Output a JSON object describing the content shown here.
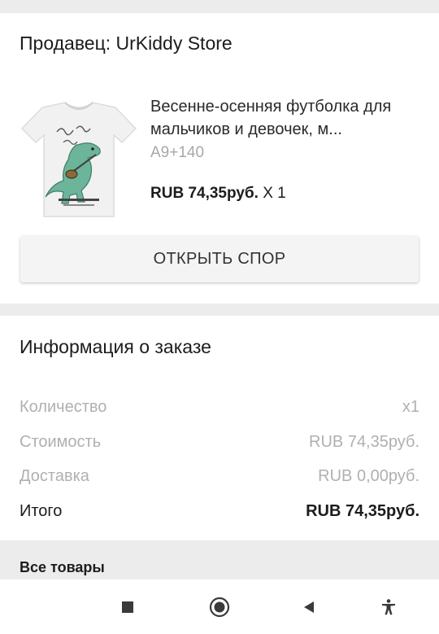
{
  "seller": {
    "title": "Продавец: UrKiddy Store"
  },
  "product": {
    "name": "Весенне-осенняя футболка для мальчиков и девочек, м...",
    "variant": "A9+140",
    "price": "RUB 74,35руб.",
    "quantity": "X 1",
    "thumbnail": "dinosaur-tshirt-image"
  },
  "actions": {
    "open_dispute": "ОТКРЫТЬ СПОР"
  },
  "order_info": {
    "title": "Информация о заказе",
    "rows": [
      {
        "label": "Количество",
        "value": "x1"
      },
      {
        "label": "Стоимость",
        "value": "RUB 74,35руб."
      },
      {
        "label": "Доставка",
        "value": "RUB 0,00руб."
      },
      {
        "label": "Итого",
        "value": "RUB 74,35руб."
      }
    ]
  },
  "all_goods": {
    "label": "Все товары"
  },
  "navbar": {
    "icons": [
      "square-stop-icon",
      "home-circle-icon",
      "back-triangle-icon",
      "accessibility-icon"
    ]
  },
  "colors": {
    "background": "#ececec",
    "card": "#ffffff",
    "muted_text": "#b0b0b0",
    "tshirt_dino": "#6cb59b"
  }
}
